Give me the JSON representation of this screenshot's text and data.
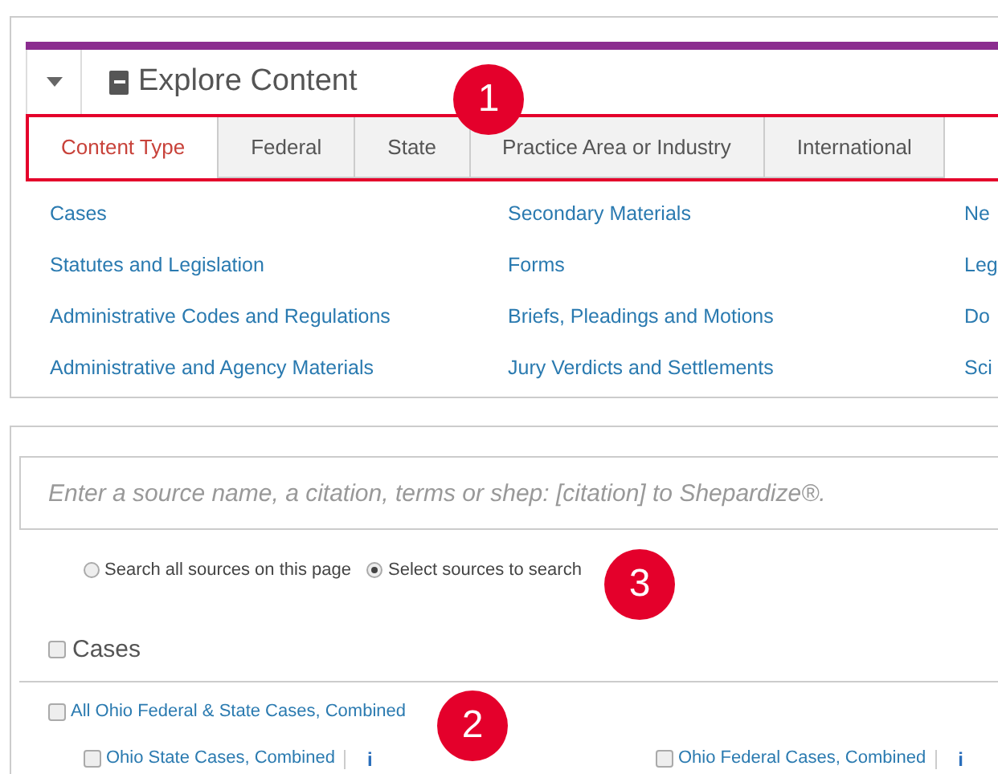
{
  "explore": {
    "title": "Explore Content",
    "tabs": [
      {
        "label": "Content Type",
        "selected": true
      },
      {
        "label": "Federal",
        "selected": false
      },
      {
        "label": "State",
        "selected": false
      },
      {
        "label": "Practice Area or Industry",
        "selected": false
      },
      {
        "label": "International",
        "selected": false
      }
    ],
    "columns": [
      [
        "Cases",
        "Statutes and Legislation",
        "Administrative Codes and Regulations",
        "Administrative and Agency Materials"
      ],
      [
        "Secondary Materials",
        "Forms",
        "Briefs, Pleadings and Motions",
        "Jury Verdicts and Settlements"
      ],
      [
        "Ne",
        "Leg",
        "Do",
        "Sci"
      ]
    ]
  },
  "search": {
    "placeholder": "Enter a source name, a citation, terms or shep: [citation] to Shepardize®.",
    "radios": [
      {
        "label": "Search all sources on this page",
        "selected": false
      },
      {
        "label": "Select sources to search",
        "selected": true
      }
    ]
  },
  "section": {
    "title": "Cases",
    "checked": false,
    "all": {
      "label": "All Ohio Federal & State Cases, Combined",
      "checked": false
    },
    "items": [
      {
        "label": "Ohio State Cases, Combined",
        "checked": false,
        "info": "i"
      },
      {
        "label": "Ohio Federal Cases, Combined",
        "checked": false,
        "info": "i"
      }
    ]
  },
  "callouts": [
    "1",
    "3",
    "2"
  ]
}
